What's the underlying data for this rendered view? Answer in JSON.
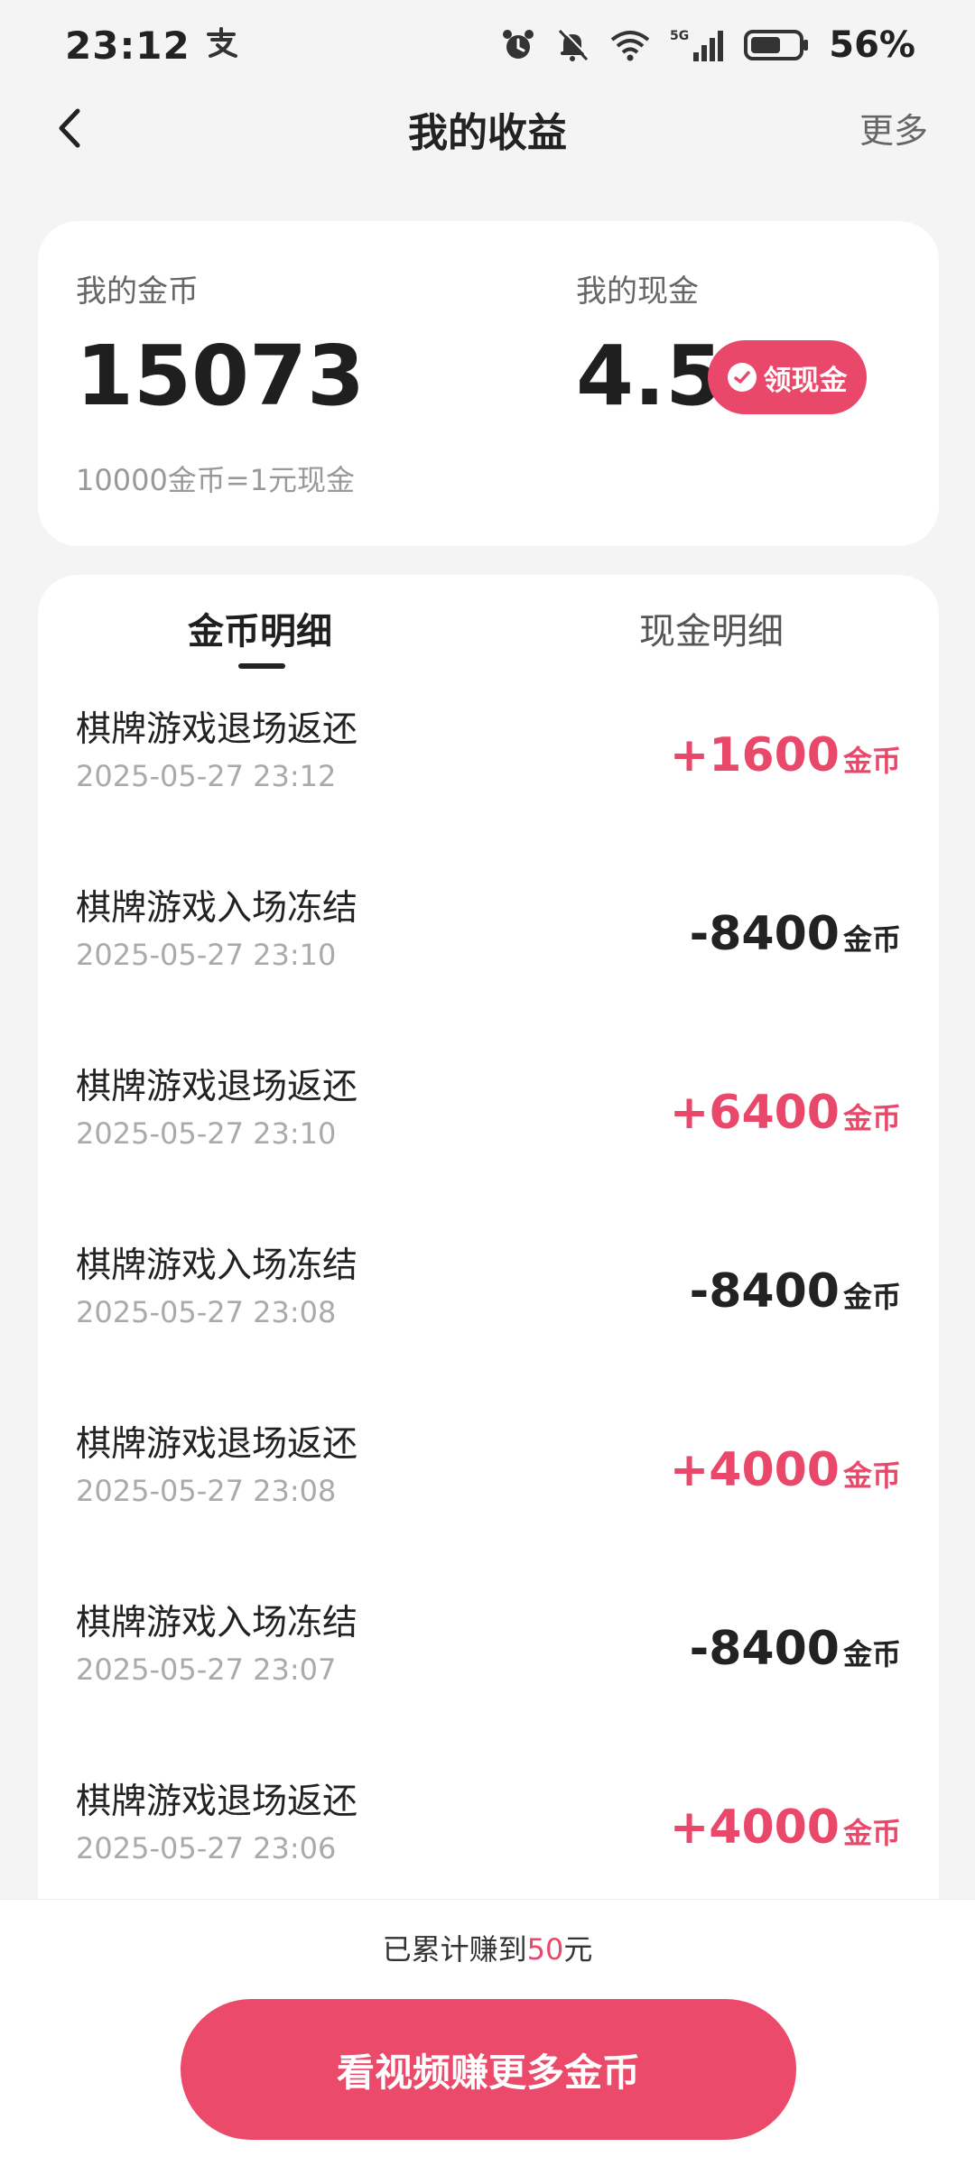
{
  "status_bar": {
    "time": "23:12",
    "battery": "56%",
    "network": "5G"
  },
  "nav": {
    "title": "我的收益",
    "more": "更多"
  },
  "summary": {
    "coin_label": "我的金币",
    "coin_value": "15073",
    "cash_label": "我的现金",
    "cash_value": "4.5",
    "withdraw_label": "领现金",
    "rate": "10000金币=1元现金"
  },
  "tabs": {
    "coin_detail": "金币明细",
    "cash_detail": "现金明细"
  },
  "records": [
    {
      "title": "棋牌游戏退场返还",
      "time": "2025-05-27 23:12",
      "amount": "+1600",
      "unit": "金币",
      "sign": "plus"
    },
    {
      "title": "棋牌游戏入场冻结",
      "time": "2025-05-27 23:10",
      "amount": "-8400",
      "unit": "金币",
      "sign": "minus"
    },
    {
      "title": "棋牌游戏退场返还",
      "time": "2025-05-27 23:10",
      "amount": "+6400",
      "unit": "金币",
      "sign": "plus"
    },
    {
      "title": "棋牌游戏入场冻结",
      "time": "2025-05-27 23:08",
      "amount": "-8400",
      "unit": "金币",
      "sign": "minus"
    },
    {
      "title": "棋牌游戏退场返还",
      "time": "2025-05-27 23:08",
      "amount": "+4000",
      "unit": "金币",
      "sign": "plus"
    },
    {
      "title": "棋牌游戏入场冻结",
      "time": "2025-05-27 23:07",
      "amount": "-8400",
      "unit": "金币",
      "sign": "minus"
    },
    {
      "title": "棋牌游戏退场返还",
      "time": "2025-05-27 23:06",
      "amount": "+4000",
      "unit": "金币",
      "sign": "plus"
    }
  ],
  "bottom": {
    "earned_prefix": "已累计赚到",
    "earned_amount": "50",
    "earned_suffix": "元",
    "cta": "看视频赚更多金币"
  },
  "colors": {
    "accent": "#e9486a",
    "background": "#f4f4f4"
  }
}
